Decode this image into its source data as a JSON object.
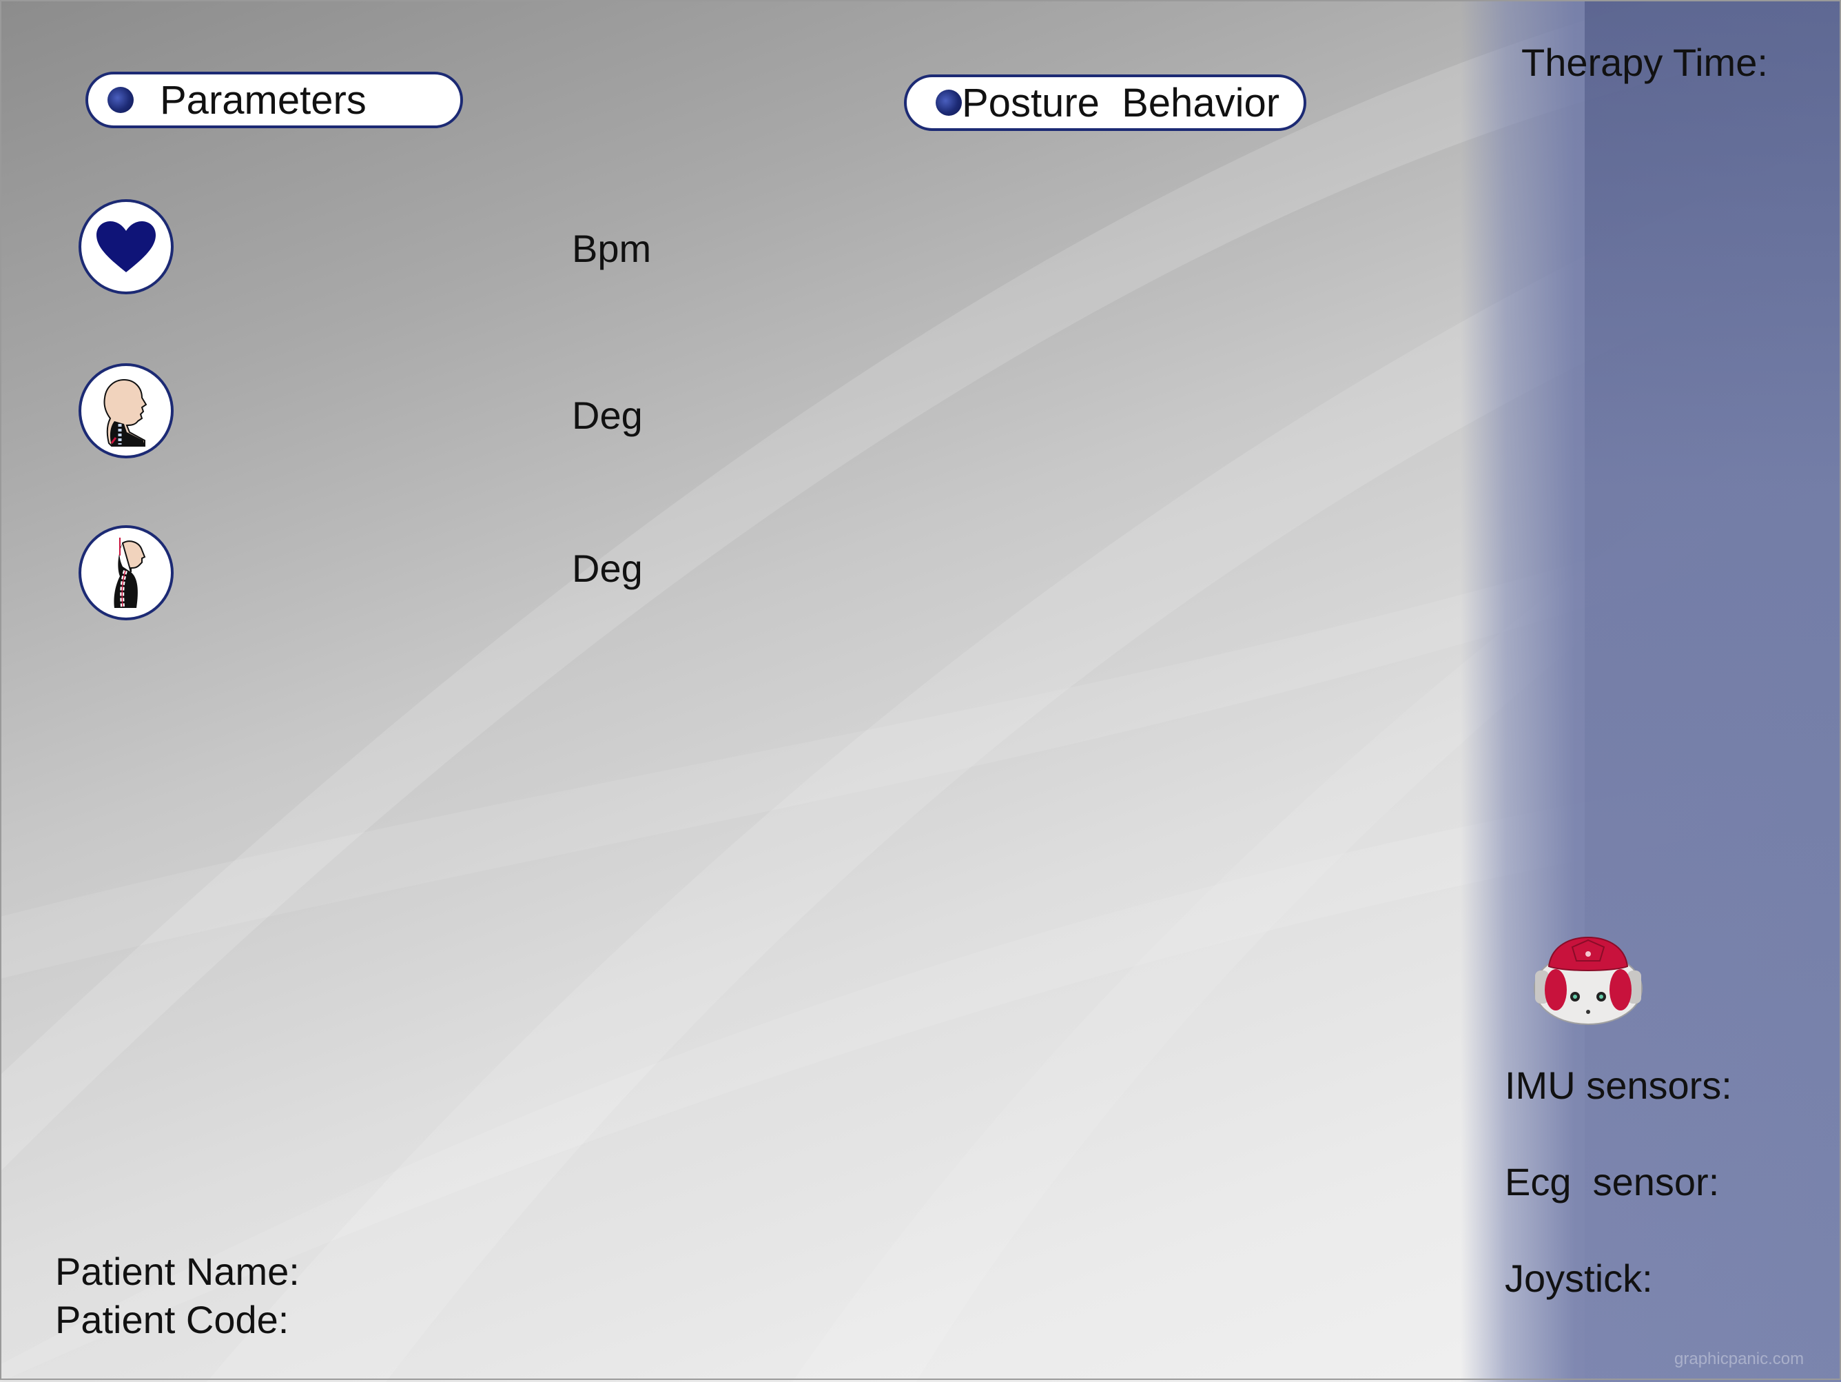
{
  "theme": {
    "accent": "#1c2a74",
    "heart_color": "#0f1478",
    "robot_red": "#c8123c"
  },
  "header": {
    "parameters_label": "Parameters",
    "posture_label": "Posture  Behavior",
    "therapy_time_label": "Therapy Time:"
  },
  "parameters": [
    {
      "icon": "heart-icon",
      "unit": "Bpm"
    },
    {
      "icon": "neck-posture-icon",
      "unit": "Deg"
    },
    {
      "icon": "spine-posture-icon",
      "unit": "Deg"
    }
  ],
  "robot": {
    "icon": "robot-head-icon"
  },
  "sensors": {
    "imu_label": "IMU sensors:",
    "ecg_label": "Ecg  sensor:",
    "joystick_label": "Joystick:"
  },
  "patient": {
    "name_label": "Patient Name:",
    "code_label": "Patient Code:"
  },
  "watermark": "graphicpanic.com"
}
